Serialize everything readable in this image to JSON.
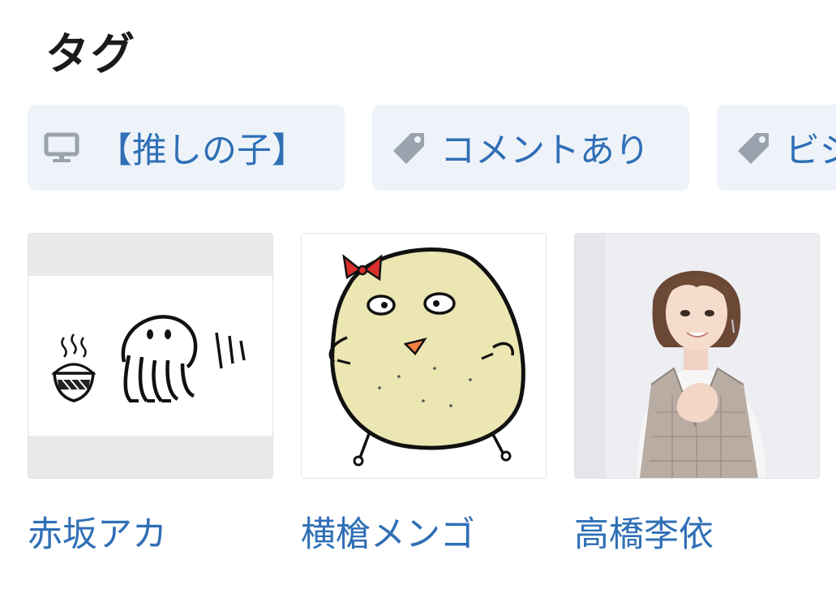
{
  "section": {
    "title": "タグ"
  },
  "tags": [
    {
      "icon": "monitor-icon",
      "label": "【推しの子】"
    },
    {
      "icon": "tag-icon",
      "label": "コメントあり"
    },
    {
      "icon": "tag-icon",
      "label": "ビジ"
    }
  ],
  "people": [
    {
      "name": "赤坂アカ"
    },
    {
      "name": "横槍メンゴ"
    },
    {
      "name": "高橋李依"
    }
  ],
  "colors": {
    "link": "#2f6fb6",
    "tag_background": "#eef3f9",
    "icon_gray": "#9aa3ad"
  }
}
